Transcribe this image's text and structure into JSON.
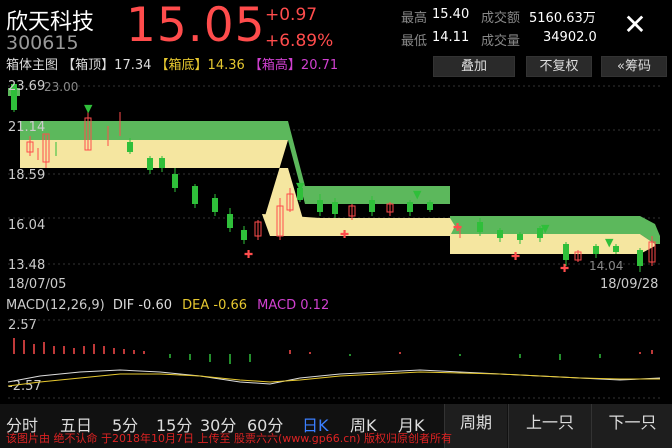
{
  "header": {
    "stock_name": "欣天科技",
    "stock_code": "300615",
    "price": "15.05",
    "change": "+0.97",
    "change_pct": "+6.89%",
    "high_label": "最高",
    "high_value": "15.40",
    "low_label": "最低",
    "low_value": "14.11",
    "turnover_label": "成交额",
    "turnover_value": "5160.63万",
    "volume_label": "成交量",
    "volume_value": "34902.0",
    "close_icon": "close-icon"
  },
  "box_indicator": {
    "title": "箱体主图",
    "top_label": "【箱顶】",
    "top_value": "17.34",
    "bottom_label": "【箱底】",
    "bottom_value": "14.36",
    "high_label": "【箱高】",
    "high_value": "20.71"
  },
  "buttons": {
    "overlay": "叠加",
    "no_adjust": "不复权",
    "chips": "«筹码"
  },
  "price_axis": {
    "labels": [
      "23.69",
      "21.14",
      "18.59",
      "16.04",
      "13.48"
    ],
    "top_marker": "23.00",
    "low_marker": "14.04",
    "start_date": "18/07/05",
    "end_date": "18/09/28"
  },
  "macd": {
    "title": "MACD(12,26,9)",
    "dif_label": "DIF",
    "dif_value": "-0.60",
    "dea_label": "DEA",
    "dea_value": "-0.66",
    "macd_label": "MACD",
    "macd_value": "0.12",
    "axis_top": "2.57",
    "axis_bottom": "-2.57"
  },
  "tabs": {
    "items": [
      "分时",
      "五日",
      "5分",
      "15分",
      "30分",
      "60分",
      "日K",
      "周K",
      "月K"
    ],
    "active": "日K"
  },
  "nav": {
    "period": "周期",
    "prev": "上一只",
    "next": "下一只"
  },
  "watermark": "该图片由 绝不认命 于2018年10月7日 上传至 股票六六(www.gp66.cn) 版权归原创者所有",
  "colors": {
    "up": "#ff4c4c",
    "down": "#2fbf3a",
    "active_tab": "#3b7fff",
    "box_top_fill": "#5cb85c",
    "box_bottom_fill": "#f5e6a0"
  }
}
